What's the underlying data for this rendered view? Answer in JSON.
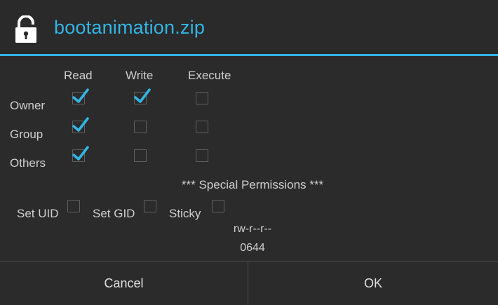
{
  "dialog": {
    "title": "bootanimation.zip",
    "icon": "unlock-icon",
    "accent_color": "#33b5e5"
  },
  "permissions": {
    "columns": [
      "Read",
      "Write",
      "Execute"
    ],
    "rows": [
      {
        "label": "Owner",
        "read": true,
        "write": true,
        "execute": false
      },
      {
        "label": "Group",
        "read": true,
        "write": false,
        "execute": false
      },
      {
        "label": "Others",
        "read": true,
        "write": false,
        "execute": false
      }
    ]
  },
  "special": {
    "title": "*** Special Permissions ***",
    "set_uid": {
      "label": "Set UID",
      "checked": false
    },
    "set_gid": {
      "label": "Set GID",
      "checked": false
    },
    "sticky": {
      "label": "Sticky",
      "checked": false
    }
  },
  "summary": {
    "string": "rw-r--r--",
    "octal": "0644"
  },
  "buttons": {
    "cancel": "Cancel",
    "ok": "OK"
  }
}
